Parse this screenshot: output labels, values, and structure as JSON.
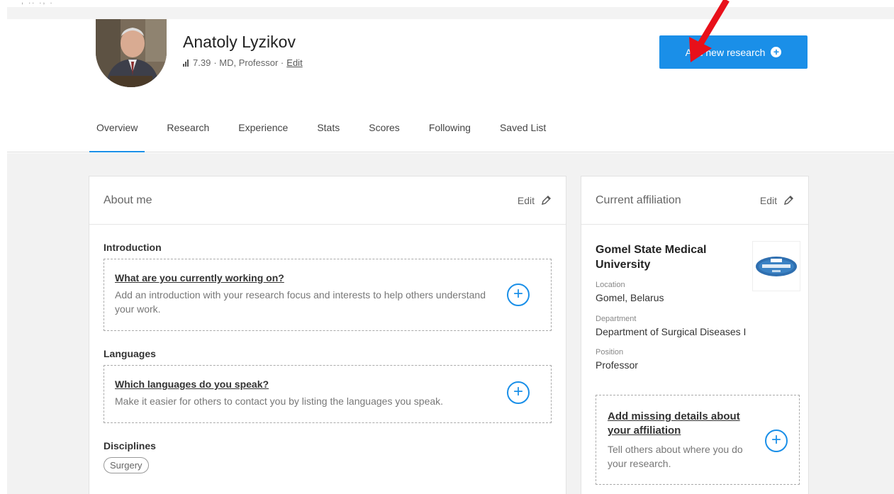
{
  "top_fragment": ", .. ., .",
  "profile": {
    "name": "Anatoly Lyzikov",
    "score": "7.39",
    "details": "· MD, Professor ·",
    "edit_label": "Edit"
  },
  "add_research_button": {
    "label": "Add new research"
  },
  "tabs": [
    {
      "label": "Overview",
      "active": true
    },
    {
      "label": "Research"
    },
    {
      "label": "Experience"
    },
    {
      "label": "Stats"
    },
    {
      "label": "Scores"
    },
    {
      "label": "Following"
    },
    {
      "label": "Saved List"
    }
  ],
  "about": {
    "title": "About me",
    "edit_label": "Edit",
    "introduction": {
      "title": "Introduction",
      "question": "What are you currently working on?",
      "description": "Add an introduction with your research focus and interests to help others understand your work."
    },
    "languages": {
      "title": "Languages",
      "question": "Which languages do you speak?",
      "description": "Make it easier for others to contact you by listing the languages you speak."
    },
    "disciplines": {
      "title": "Disciplines",
      "items": [
        "Surgery"
      ]
    }
  },
  "affiliation": {
    "title": "Current affiliation",
    "edit_label": "Edit",
    "institution": "Gomel State Medical University",
    "location_label": "Location",
    "location": "Gomel, Belarus",
    "department_label": "Department",
    "department": "Department of Surgical Diseases I",
    "position_label": "Position",
    "position": "Professor",
    "missing": {
      "question": "Add missing details about your affiliation",
      "description": "Tell others about where you do your research."
    }
  },
  "colors": {
    "accent": "#1a8fe8",
    "arrow": "#e8101a",
    "background": "#f2f2f2"
  }
}
